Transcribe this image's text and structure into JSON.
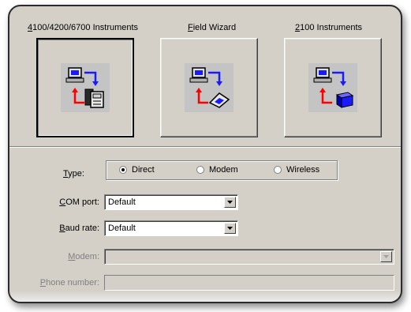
{
  "instrument_tabs": [
    {
      "label_prefix": "",
      "label_key": "4",
      "label_rest": "100/4200/6700 Instruments",
      "icon": "pc-link-meter-icon",
      "selected": true
    },
    {
      "label_prefix": "",
      "label_key": "F",
      "label_rest": "ield Wizard",
      "icon": "pc-link-probe-icon",
      "selected": false
    },
    {
      "label_prefix": "",
      "label_key": "2",
      "label_rest": "100 Instruments",
      "icon": "pc-link-module-icon",
      "selected": false
    }
  ],
  "type": {
    "label_key": "T",
    "label_rest": "ype:",
    "options": [
      {
        "label": "Direct",
        "checked": true
      },
      {
        "label": "Modem",
        "checked": false
      },
      {
        "label": "Wireless",
        "checked": false
      }
    ]
  },
  "com_port": {
    "label_key": "C",
    "label_rest": "OM port:",
    "value": "Default"
  },
  "baud_rate": {
    "label_key": "B",
    "label_rest": "aud rate:",
    "value": "Default"
  },
  "modem": {
    "label_key": "M",
    "label_rest": "odem:",
    "value": "",
    "disabled": true
  },
  "phone_number": {
    "label_key": "P",
    "label_rest": "hone number:",
    "value": "",
    "disabled": true
  },
  "colors": {
    "panel": "#d4d0c8",
    "arrow_red": "#ff0000",
    "arrow_blue": "#1a1aff",
    "icon_bg": "#c4c4c4"
  }
}
